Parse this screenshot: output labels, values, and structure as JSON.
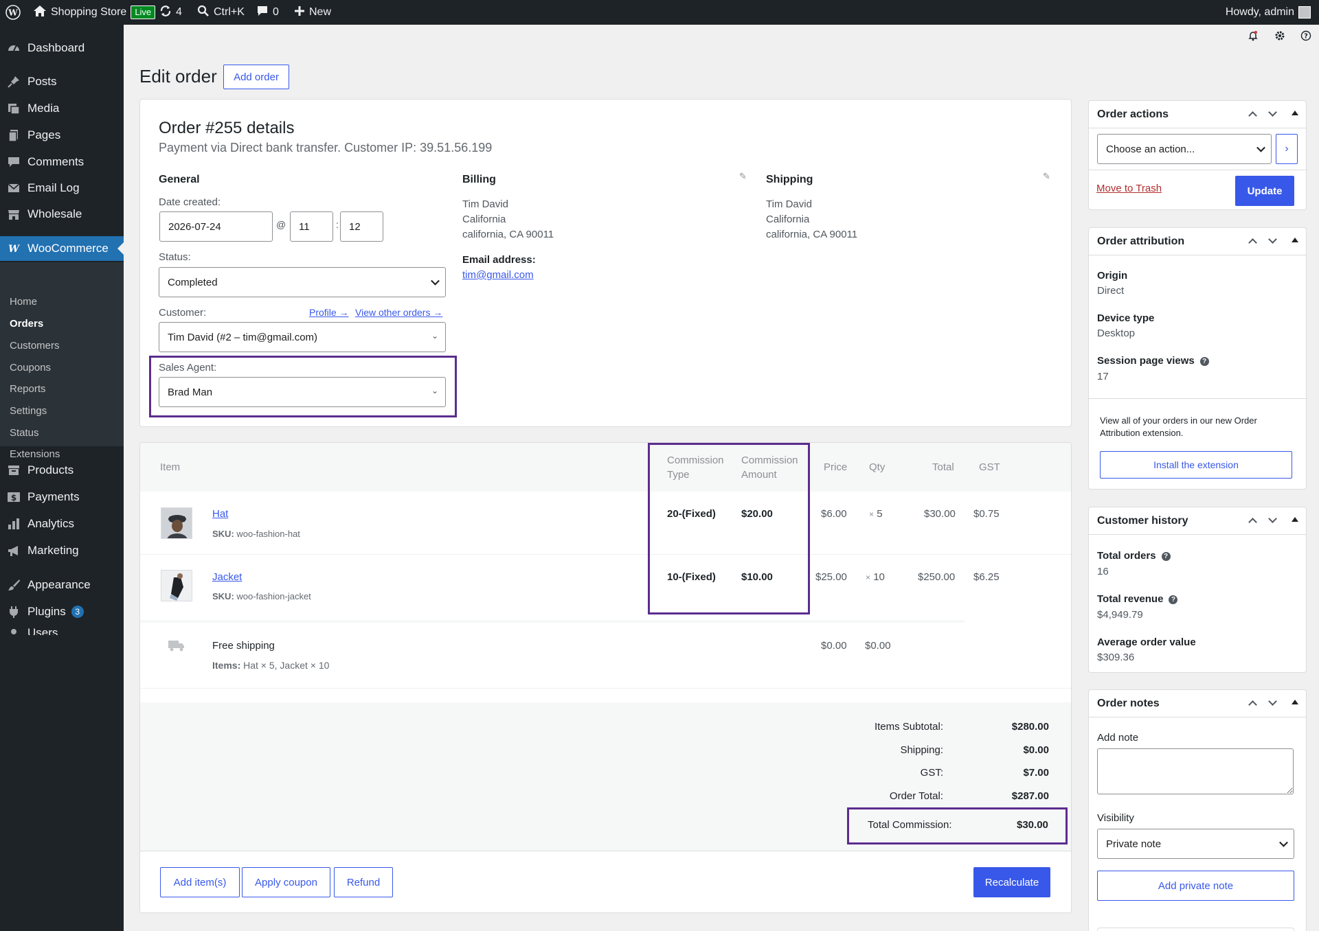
{
  "adminbar": {
    "site_name": "Shopping Store",
    "live_badge": "Live",
    "updates_count": "4",
    "search_shortcut": "Ctrl+K",
    "comments_count": "0",
    "new_label": "New",
    "howdy": "Howdy, admin"
  },
  "sidebar": {
    "dashboard": "Dashboard",
    "posts": "Posts",
    "media": "Media",
    "pages": "Pages",
    "comments": "Comments",
    "email_log": "Email Log",
    "wholesale": "Wholesale",
    "woocommerce": "WooCommerce",
    "sub": {
      "home": "Home",
      "orders": "Orders",
      "customers": "Customers",
      "coupons": "Coupons",
      "reports": "Reports",
      "settings": "Settings",
      "status": "Status",
      "extensions": "Extensions"
    },
    "products": "Products",
    "payments": "Payments",
    "analytics": "Analytics",
    "marketing": "Marketing",
    "appearance": "Appearance",
    "plugins": "Plugins",
    "plugins_count": "3",
    "users": "Users"
  },
  "page": {
    "title": "Edit order",
    "add_order": "Add order"
  },
  "order": {
    "heading": "Order #255 details",
    "subheading": "Payment via Direct bank transfer. Customer IP: 39.51.56.199",
    "general_title": "General",
    "date_label": "Date created:",
    "date_value": "2026-07-24",
    "at_sign": "@",
    "hour": "11",
    "colon": ":",
    "minute": "12",
    "status_label": "Status:",
    "status_value": "Completed",
    "customer_label": "Customer:",
    "profile_link": "Profile →",
    "other_orders_link": "View other orders →",
    "customer_value": "Tim David (#2 – tim@gmail.com)",
    "sales_agent_label": "Sales Agent:",
    "sales_agent_value": "Brad Man",
    "billing_title": "Billing",
    "billing_name": "Tim David",
    "billing_state": "California",
    "billing_city": "california, CA 90011",
    "email_label": "Email address:",
    "email_value": "tim@gmail.com",
    "shipping_title": "Shipping",
    "shipping_name": "Tim David",
    "shipping_state": "California",
    "shipping_city": "california, CA 90011"
  },
  "items": {
    "headers": {
      "item": "Item",
      "commission_type_1": "Commission",
      "commission_type_2": "Type",
      "commission_amount_1": "Commission",
      "commission_amount_2": "Amount",
      "price": "Price",
      "qty": "Qty",
      "total": "Total",
      "gst": "GST"
    },
    "rows": [
      {
        "name": "Hat",
        "sku_label": "SKU:",
        "sku": "woo-fashion-hat",
        "commission_type": "20-(Fixed)",
        "commission_amount": "$20.00",
        "price": "$6.00",
        "qty_x": "×",
        "qty": "5",
        "total": "$30.00",
        "gst": "$0.75"
      },
      {
        "name": "Jacket",
        "sku_label": "SKU:",
        "sku": "woo-fashion-jacket",
        "commission_type": "10-(Fixed)",
        "commission_amount": "$10.00",
        "price": "$25.00",
        "qty_x": "×",
        "qty": "10",
        "total": "$250.00",
        "gst": "$6.25"
      }
    ],
    "shipping": {
      "name": "Free shipping",
      "items_label": "Items:",
      "items_value": "Hat × 5, Jacket × 10",
      "price": "$0.00",
      "tax": "$0.00"
    },
    "totals": {
      "subtotal_label": "Items Subtotal:",
      "subtotal": "$280.00",
      "shipping_label": "Shipping:",
      "shipping": "$0.00",
      "gst_label": "GST:",
      "gst": "$7.00",
      "order_total_label": "Order Total:",
      "order_total": "$287.00",
      "commission_label": "Total Commission:",
      "commission": "$30.00"
    },
    "buttons": {
      "add_items": "Add item(s)",
      "apply_coupon": "Apply coupon",
      "refund": "Refund",
      "recalculate": "Recalculate"
    }
  },
  "order_actions": {
    "title": "Order actions",
    "select_value": "Choose an action...",
    "trash": "Move to Trash",
    "update": "Update"
  },
  "attribution": {
    "title": "Order attribution",
    "origin_label": "Origin",
    "origin_value": "Direct",
    "device_label": "Device type",
    "device_value": "Desktop",
    "views_label": "Session page views",
    "views_value": "17",
    "note": "View all of your orders in our new Order Attribution extension.",
    "install": "Install the extension"
  },
  "history": {
    "title": "Customer history",
    "total_orders_label": "Total orders",
    "total_orders": "16",
    "revenue_label": "Total revenue",
    "revenue": "$4,949.79",
    "aov_label": "Average order value",
    "aov": "$309.36"
  },
  "notes": {
    "title": "Order notes",
    "add_note_label": "Add note",
    "visibility_label": "Visibility",
    "visibility_value": "Private note",
    "add_button": "Add private note"
  },
  "colors": {
    "accent": "#3858e9",
    "highlight_box": "#5b2d8e",
    "admin_dark": "#1d2327",
    "menu_active": "#2271b1"
  }
}
